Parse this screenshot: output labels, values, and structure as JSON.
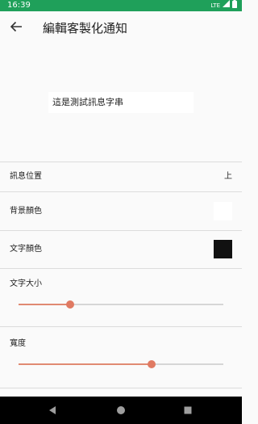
{
  "status_bar": {
    "time": "16:39",
    "network": "LTE",
    "background_color": "#1fa05a"
  },
  "app_bar": {
    "title": "編輯客製化通知",
    "back_icon": "arrow-left-icon"
  },
  "preview": {
    "text": "這是測試訊息字串"
  },
  "settings": {
    "position": {
      "label": "訊息位置",
      "value": "上"
    },
    "background_color": {
      "label": "背景顏色",
      "color": "#ffffff"
    },
    "text_color": {
      "label": "文字顏色",
      "color": "#111111"
    },
    "text_size": {
      "label": "文字大小",
      "value_fraction": 0.25
    },
    "width": {
      "label": "寬度",
      "value_fraction": 0.65
    }
  },
  "accent_color": "#e07a62",
  "nav_bar": {
    "back_icon": "triangle-back-icon",
    "home_icon": "circle-home-icon",
    "recents_icon": "square-recents-icon"
  }
}
